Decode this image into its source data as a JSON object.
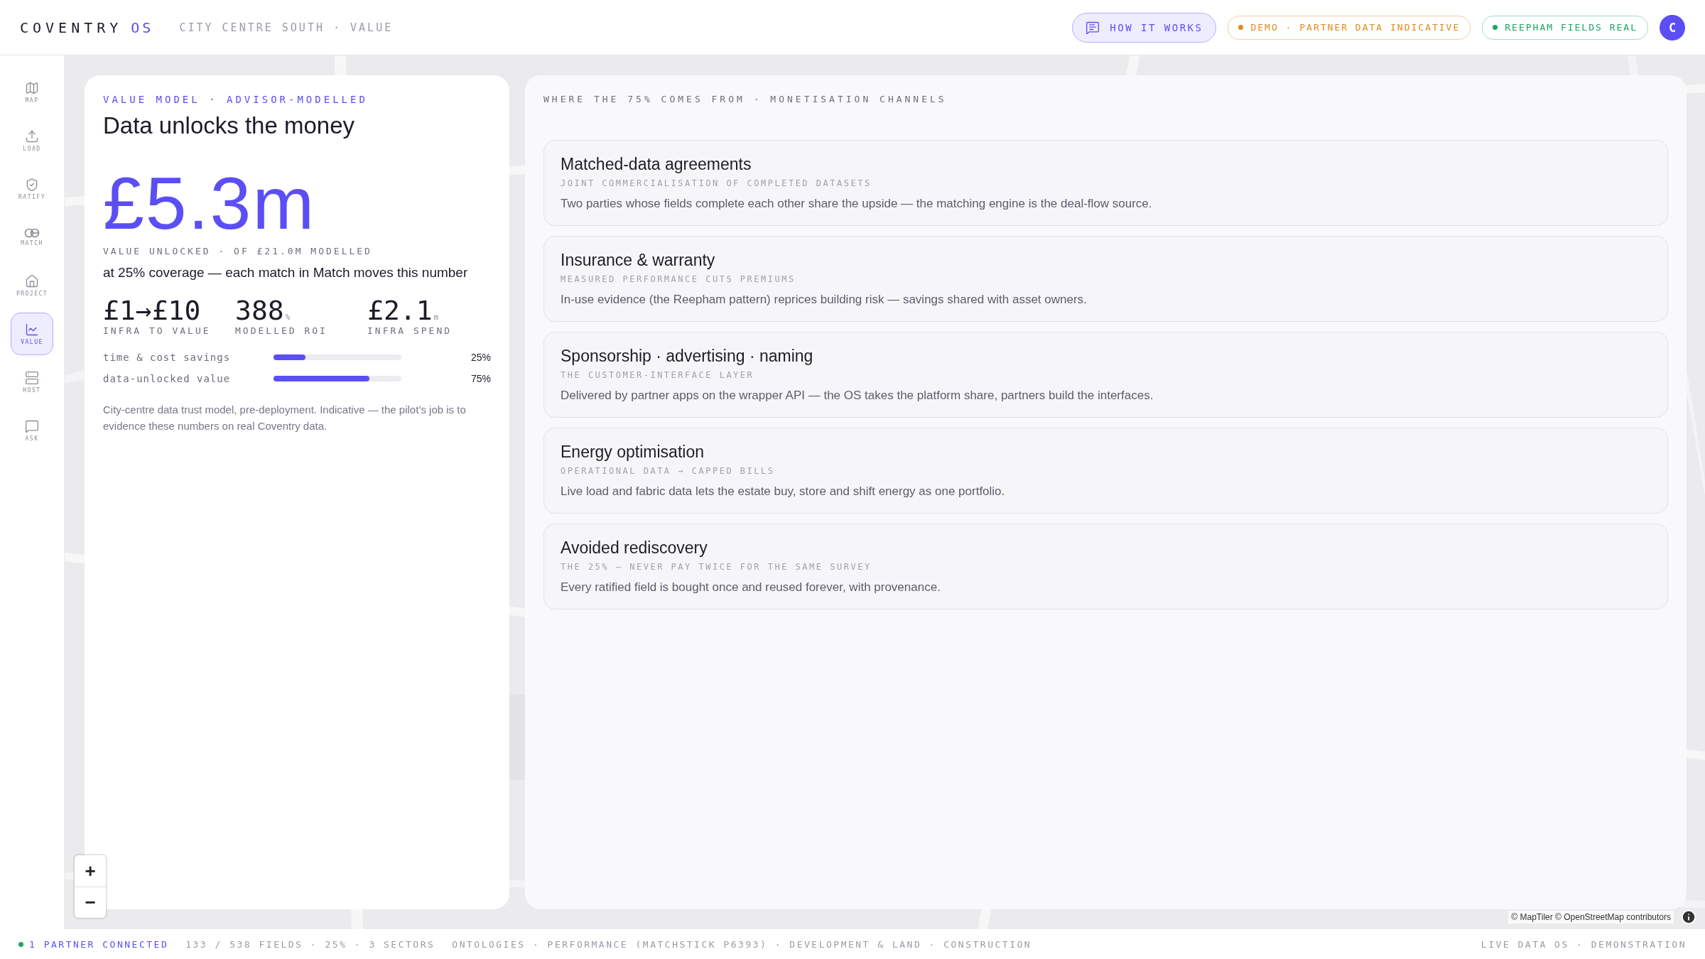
{
  "header": {
    "brand": "COVENTRY",
    "brand_suffix": "OS",
    "breadcrumb": "CITY CENTRE SOUTH · VALUE",
    "help_button": "HOW IT WORKS",
    "badges": [
      {
        "label": "DEMO · PARTNER DATA INDICATIVE",
        "color": "#e08a1e"
      },
      {
        "label": "REEPHAM FIELDS REAL",
        "color": "#1fa463"
      }
    ],
    "avatar": "C"
  },
  "sidebar": {
    "items": [
      {
        "kind": "map",
        "label": "MAP",
        "selected": false
      },
      {
        "kind": "load",
        "label": "LOAD",
        "selected": false
      },
      {
        "kind": "ratify",
        "label": "RATIFY",
        "selected": false
      },
      {
        "kind": "match",
        "label": "MATCH",
        "selected": false
      },
      {
        "kind": "project",
        "label": "PROJECT",
        "selected": false
      },
      {
        "kind": "value",
        "label": "VALUE",
        "selected": true
      },
      {
        "kind": "host",
        "label": "HOST",
        "selected": false
      },
      {
        "kind": "ask",
        "label": "ASK",
        "selected": false
      }
    ]
  },
  "value_card": {
    "eyebrow": "VALUE MODEL · ADVISOR-MODELLED",
    "title": "Data unlocks the money",
    "headline": "£5.3m",
    "headline_caption": "VALUE UNLOCKED · OF £21.0M MODELLED",
    "headline_note": "at 25% coverage — each match in Match moves this number",
    "stats": [
      {
        "value": "£1→£10",
        "label": "INFRA TO VALUE"
      },
      {
        "value": "388",
        "unit": "%",
        "label": "MODELLED ROI"
      },
      {
        "value": "£2.1",
        "unit": "m",
        "label": "INFRA SPEND"
      }
    ],
    "bars": [
      {
        "label": "time & cost savings",
        "level": 0.25,
        "reading": "25%"
      },
      {
        "label": "data-unlocked value",
        "level": 0.75,
        "reading": "75%"
      }
    ],
    "footnote": "City-centre data trust model, pre-deployment. Indicative — the pilot’s job is to evidence these numbers on real Coventry data."
  },
  "channels_card": {
    "heading": "WHERE THE 75% COMES FROM · MONETISATION CHANNELS",
    "channels": [
      {
        "title": "Matched-data agreements",
        "subtitle": "JOINT COMMERCIALISATION OF COMPLETED DATASETS",
        "description": "Two parties whose fields complete each other share the upside — the matching engine is the deal-flow source."
      },
      {
        "title": "Insurance & warranty",
        "subtitle": "MEASURED PERFORMANCE CUTS PREMIUMS",
        "description": "In-use evidence (the Reepham pattern) reprices building risk — savings shared with asset owners."
      },
      {
        "title": "Sponsorship · advertising · naming",
        "subtitle": "THE CUSTOMER-INTERFACE LAYER",
        "description": "Delivered by partner apps on the wrapper API — the OS takes the platform share, partners build the interfaces."
      },
      {
        "title": "Energy optimisation",
        "subtitle": "OPERATIONAL DATA → CAPPED BILLS",
        "description": "Live load and fabric data lets the estate buy, store and shift energy as one portfolio."
      },
      {
        "title": "Avoided rediscovery",
        "subtitle": "THE 25% — NEVER PAY TWICE FOR THE SAME SURVEY",
        "description": "Every ratified field is bought once and reused forever, with provenance."
      }
    ]
  },
  "map": {
    "zoom_in": "+",
    "zoom_out": "−",
    "attribution": "© MapTiler © OpenStreetMap contributors"
  },
  "status_bar": {
    "connection": {
      "label": "1 PARTNER CONNECTED",
      "color": "#1fa463"
    },
    "items": [
      "133 / 538 FIELDS · 25% · 3 SECTORS",
      "ONTOLOGIES · PERFORMANCE (MATCHSTICK P6393) · DEVELOPMENT & LAND · CONSTRUCTION"
    ],
    "right": "LIVE DATA OS · DEMONSTRATION"
  }
}
